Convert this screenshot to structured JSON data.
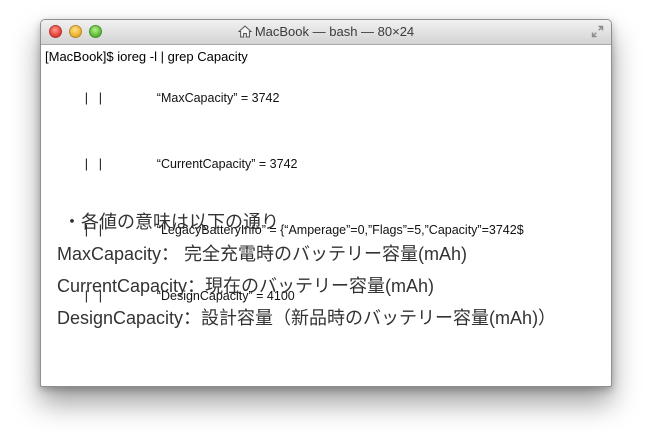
{
  "window": {
    "title": "MacBook — bash — 80×24"
  },
  "terminal": {
    "prompt": "[MacBook]$ ioreg -l | grep Capacity",
    "output": [
      {
        "pipes": "|   |",
        "text": "“MaxCapacity” = 3742"
      },
      {
        "pipes": "|   |",
        "text": "“CurrentCapacity” = 3742"
      },
      {
        "pipes": "|   |",
        "text": "“LegacyBatteryInfo” = {“Amperage”=0,”Flags”=5,”Capacity”=3742$"
      },
      {
        "pipes": "|   |",
        "text": "“DesignCapacity” = 4100"
      }
    ]
  },
  "notes": {
    "heading": "・各値の意味は以下の通り",
    "lines": [
      "MaxCapacity： 完全充電時のバッテリー容量(mAh)",
      "CurrentCapacity：現在のバッテリー容量(mAh)",
      "DesignCapacity：設計容量（新品時のバッテリー容量(mAh)）"
    ]
  }
}
